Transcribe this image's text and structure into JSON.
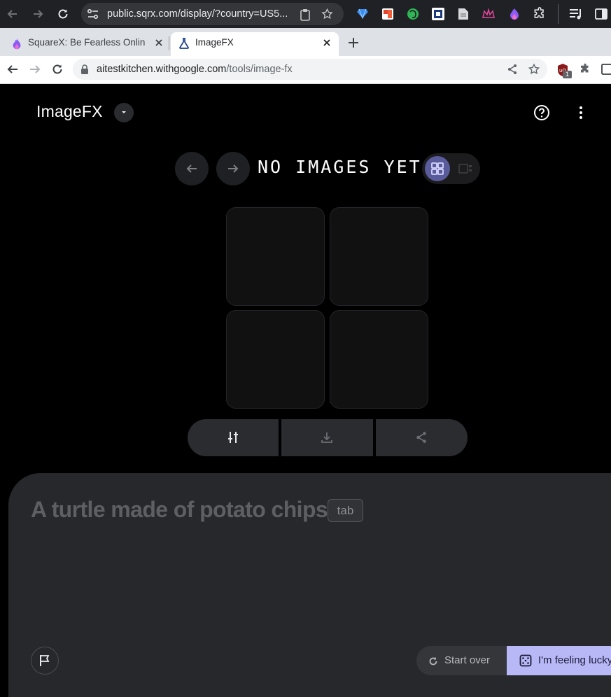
{
  "outer_browser": {
    "url": "public.sqrx.com/display/?country=US5..."
  },
  "tabs": [
    {
      "title": "SquareX: Be Fearless Onlin",
      "active": false
    },
    {
      "title": "ImageFX",
      "active": true
    }
  ],
  "address_bar": {
    "domain": "aitestkitchen.withgoogle.com",
    "path": "/tools/image-fx",
    "extension_badge": "1"
  },
  "app": {
    "title": "ImageFX",
    "heading": "NO IMAGES YET",
    "prompt_placeholder": "A turtle made of potato chips",
    "tab_hint": "tab",
    "start_over_label": "Start over",
    "lucky_label": "I'm feeling lucky",
    "colors": {
      "background": "#000000",
      "panel": "#27282b",
      "accent": "#b8b8f6",
      "toggle_active": "#5a5b9b"
    }
  },
  "icons": [
    "back-icon",
    "forward-icon",
    "reload-icon",
    "site-info-icon",
    "clipboard-icon",
    "star-icon",
    "extension-icon",
    "sidebar-icon",
    "new-tab-icon",
    "close-icon",
    "lock-icon",
    "share-icon",
    "dropdown-icon",
    "help-icon",
    "more-vert-icon",
    "arrow-left-icon",
    "arrow-right-icon",
    "grid-view-icon",
    "list-view-icon",
    "tune-icon",
    "download-icon",
    "share-icon",
    "refresh-icon",
    "dice-icon",
    "flag-icon"
  ]
}
